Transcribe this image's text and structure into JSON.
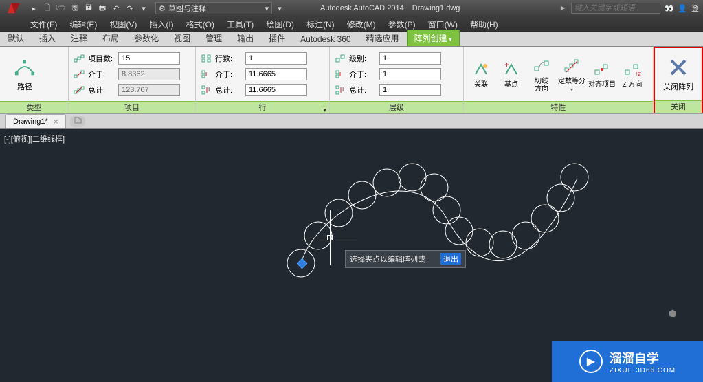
{
  "app": {
    "product": "Autodesk AutoCAD 2014",
    "doc": "Drawing1.dwg",
    "search_placeholder": "键入关键字或短语",
    "login": "登",
    "workspace": "草图与注释",
    "play": "►"
  },
  "menus": [
    "文件(F)",
    "编辑(E)",
    "视图(V)",
    "插入(I)",
    "格式(O)",
    "工具(T)",
    "绘图(D)",
    "标注(N)",
    "修改(M)",
    "参数(P)",
    "窗口(W)",
    "帮助(H)"
  ],
  "ribbon_tabs": [
    "默认",
    "插入",
    "注释",
    "布局",
    "参数化",
    "视图",
    "管理",
    "输出",
    "插件",
    "Autodesk 360",
    "精选应用",
    "阵列创建"
  ],
  "ribbon_active": 11,
  "panels": {
    "type": {
      "title": "类型",
      "btn": "路径"
    },
    "items": {
      "title": "项目",
      "rows": [
        {
          "label": "项目数:",
          "value": "15",
          "ro": false
        },
        {
          "label": "介于:",
          "value": "8.8362",
          "ro": true
        },
        {
          "label": "总计:",
          "value": "123.707",
          "ro": true
        }
      ]
    },
    "rows": {
      "title": "行",
      "rows": [
        {
          "label": "行数:",
          "value": "1"
        },
        {
          "label": "介于:",
          "value": "11.6665"
        },
        {
          "label": "总计:",
          "value": "11.6665"
        }
      ]
    },
    "levels": {
      "title": "层级",
      "rows": [
        {
          "label": "级别:",
          "value": "1"
        },
        {
          "label": "介于:",
          "value": "1"
        },
        {
          "label": "总计:",
          "value": "1"
        }
      ]
    },
    "props": {
      "title": "特性",
      "btns": [
        {
          "label": "关联"
        },
        {
          "label": "基点"
        },
        {
          "label": "切线\n方向"
        },
        {
          "label": "定数等分"
        },
        {
          "label": "对齐项目"
        },
        {
          "label": "Z 方向"
        }
      ]
    },
    "close": {
      "title": "关闭",
      "btn": "关闭阵列"
    }
  },
  "doc_tab": "Drawing1*",
  "canvas": {
    "view_label": "[-][俯视][二维线框]",
    "tooltip_text": "选择夹点以编辑阵列或",
    "tooltip_exit": "退出"
  },
  "watermark": {
    "big": "溜溜自学",
    "small": "ZIXUE.3D66.COM"
  }
}
